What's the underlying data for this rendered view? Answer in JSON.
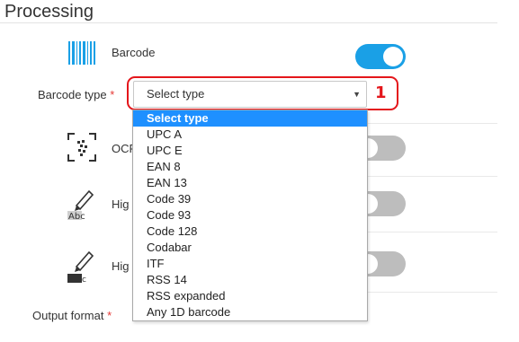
{
  "section": {
    "title": "Processing"
  },
  "rows": {
    "barcode": {
      "label": "Barcode",
      "enabled": true
    },
    "ocr": {
      "label": "OCR",
      "enabled": false
    },
    "highlight1": {
      "label": "Hig",
      "enabled": false
    },
    "highlight2": {
      "label": "Hig",
      "enabled": false
    }
  },
  "barcode_type": {
    "label": "Barcode type",
    "required_mark": "*",
    "selected": "Select type",
    "caret": "▼",
    "options": [
      "Select type",
      "UPC A",
      "UPC E",
      "EAN 8",
      "EAN 13",
      "Code 39",
      "Code 93",
      "Code 128",
      "Codabar",
      "ITF",
      "RSS 14",
      "RSS expanded",
      "Any 1D barcode"
    ]
  },
  "output_format": {
    "label": "Output format",
    "required_mark": "*"
  },
  "annotation": {
    "number": "1",
    "color": "#e4161b"
  },
  "colors": {
    "accent": "#1aa0e6",
    "toggle_off": "#bdbdbd",
    "selected_option": "#1e90ff"
  },
  "icons": {
    "barcode": "barcode-icon",
    "ocr": "ocr-scan-icon",
    "highlight_text": "highlight-text-icon",
    "highlight": "highlight-marker-icon"
  }
}
